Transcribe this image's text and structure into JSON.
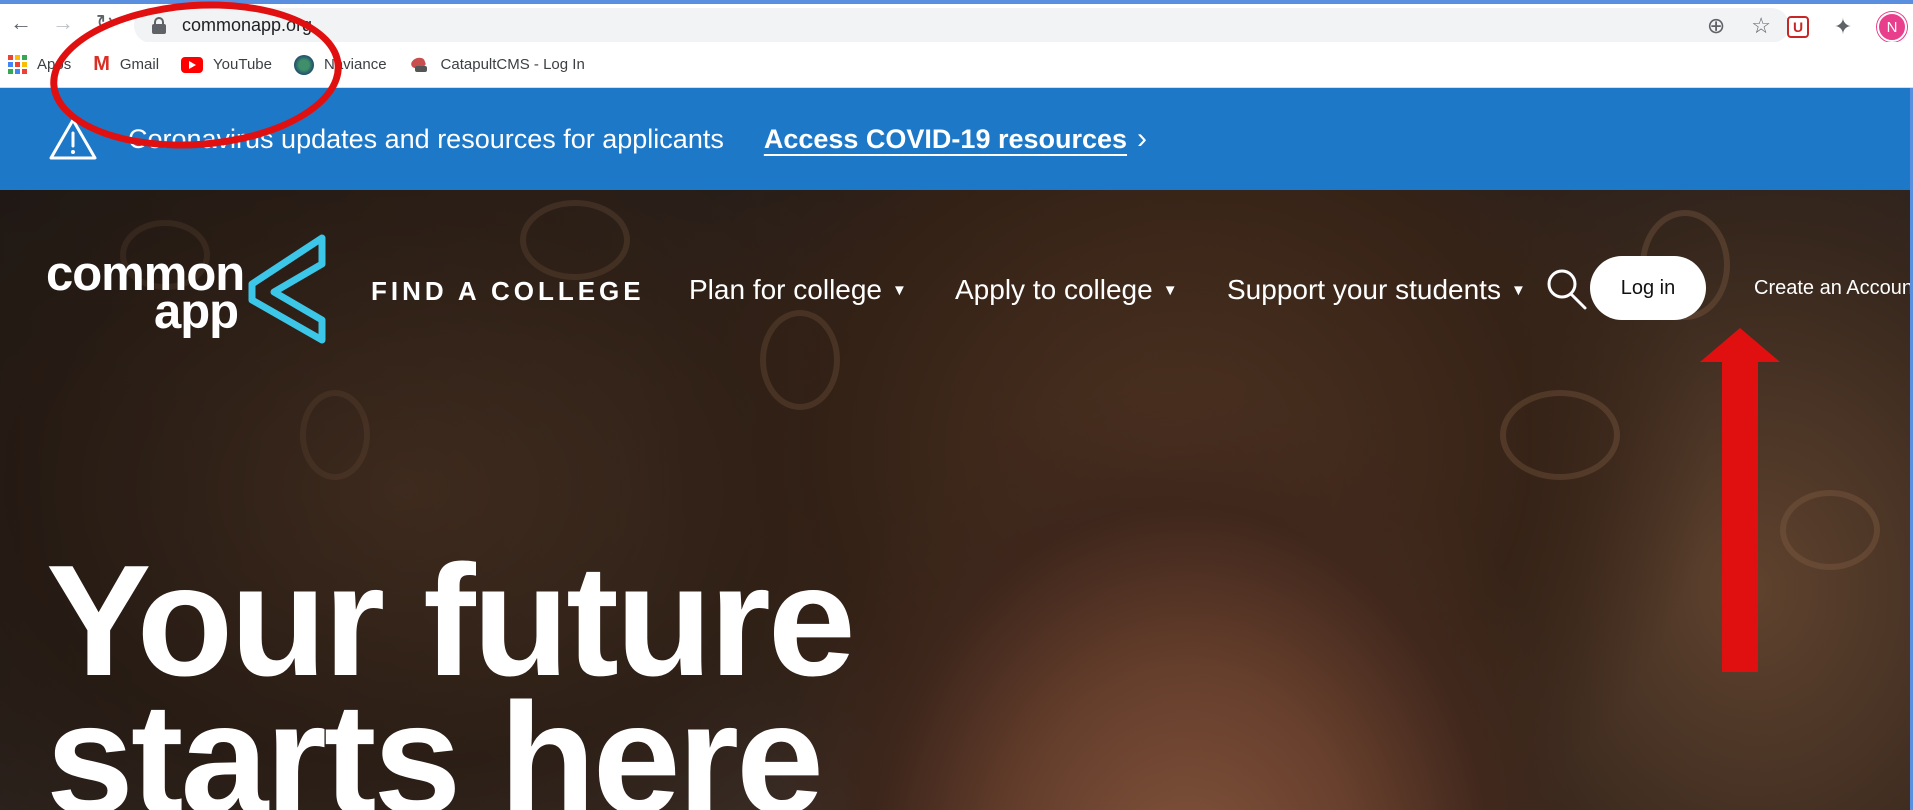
{
  "browser": {
    "url": "commonapp.org",
    "profile_initial": "N"
  },
  "bookmarks": [
    {
      "label": "Apps",
      "icon": "apps-icon"
    },
    {
      "label": "Gmail",
      "icon": "gmail-icon"
    },
    {
      "label": "YouTube",
      "icon": "youtube-icon"
    },
    {
      "label": "Naviance",
      "icon": "naviance-icon"
    },
    {
      "label": "CatapultCMS - Log In",
      "icon": "catapult-icon"
    }
  ],
  "banner": {
    "text": "Coronavirus updates and resources for applicants",
    "link": "Access COVID-19 resources",
    "color": "#1d78c8"
  },
  "site_nav": {
    "logo_line1": "common",
    "logo_line2": "app",
    "find_college": "FIND A COLLEGE",
    "plan": "Plan for college",
    "apply": "Apply to college",
    "support": "Support your students",
    "login": "Log in",
    "create_account": "Create an Account"
  },
  "hero": {
    "line1": "Your future",
    "line2": "starts here"
  },
  "annotations": {
    "color": "#e01010"
  }
}
